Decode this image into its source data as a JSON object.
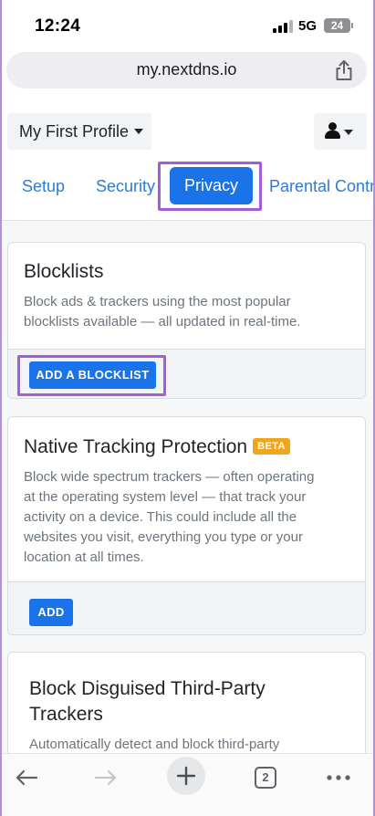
{
  "status_bar": {
    "time": "12:24",
    "network": "5G",
    "battery": "24"
  },
  "browser": {
    "url": "my.nextdns.io"
  },
  "profile": {
    "name": "My First Profile"
  },
  "tabs": [
    {
      "label": "Setup"
    },
    {
      "label": "Security"
    },
    {
      "label": "Privacy",
      "active": true
    },
    {
      "label": "Parental Control"
    }
  ],
  "cards": {
    "blocklists": {
      "title": "Blocklists",
      "description_lines": [
        "Block ads & trackers using the most popular",
        "blocklists available — all updated in real-time."
      ],
      "button": "ADD A BLOCKLIST"
    },
    "native_tracking": {
      "title": "Native Tracking Protection",
      "badge": "BETA",
      "description_lines": [
        "Block wide spectrum trackers — often operating",
        "at the operating system level — that track your",
        "activity on a device. This could include all the",
        "websites you visit, everything you type or your",
        "location at all times."
      ],
      "button": "ADD"
    },
    "disguised_trackers": {
      "title_lines": [
        "Block Disguised Third-Party",
        "Trackers"
      ],
      "description_lines": [
        "Automatically detect and block third-party"
      ]
    }
  },
  "toolbar": {
    "tab_count": "2"
  },
  "colors": {
    "accent": "#1a73e8",
    "highlight": "#a05ed9",
    "badge": "#f0a51c"
  },
  "icons": [
    "share-icon",
    "user-icon",
    "back-icon",
    "forward-icon",
    "new-tab-icon",
    "tabs-icon",
    "more-icon"
  ]
}
